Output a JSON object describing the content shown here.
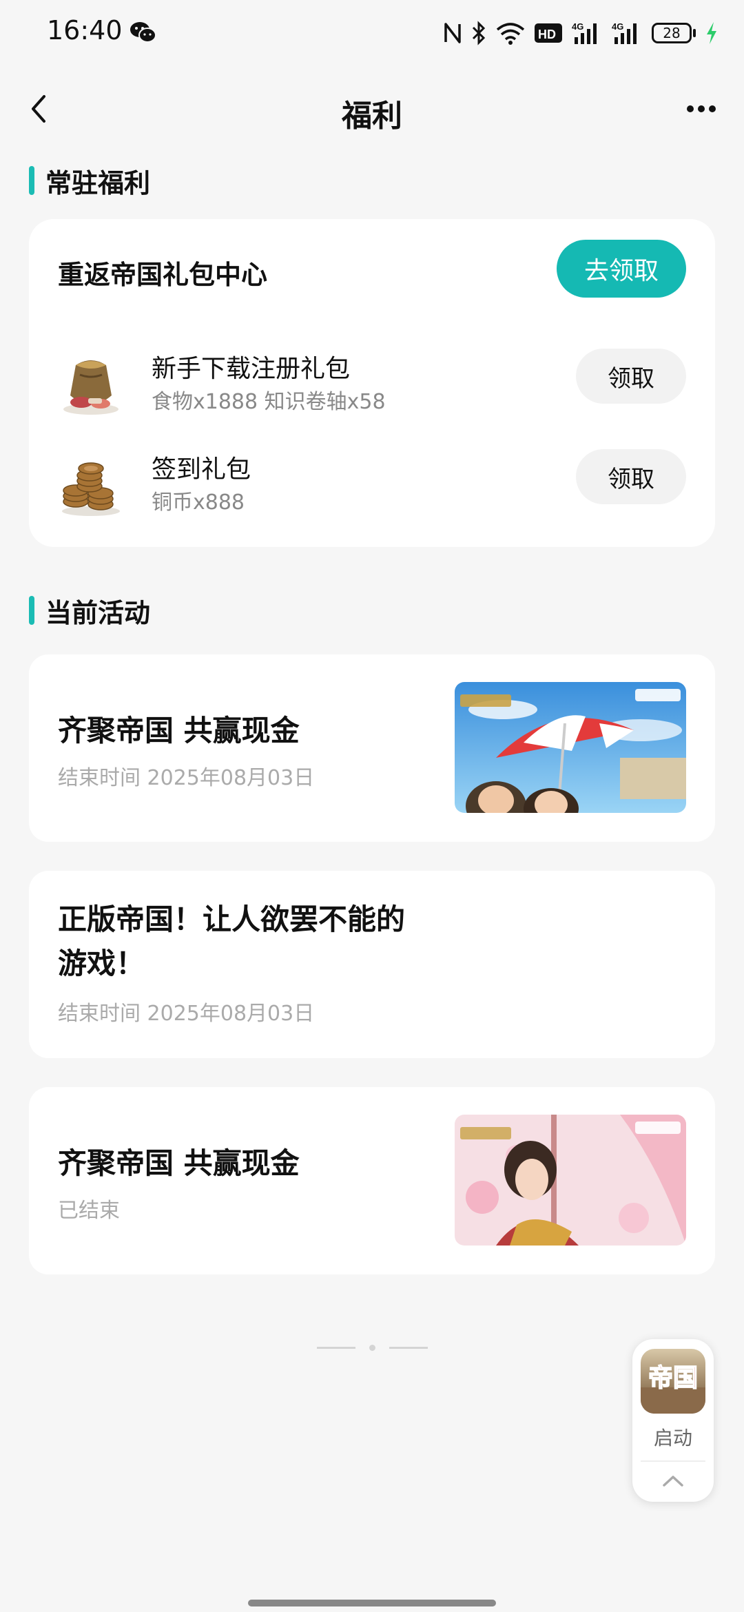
{
  "status_bar": {
    "time": "16:40",
    "network_4g_label": "4G",
    "hd_label": "HD",
    "battery": "28"
  },
  "nav": {
    "title": "福利"
  },
  "permanent_welfare": {
    "section_title": "常驻福利",
    "card_title": "重返帝国礼包中心",
    "claim_all_label": "去领取",
    "gifts": [
      {
        "name": "新手下载注册礼包",
        "desc": "食物x1888 知识卷轴x58",
        "button": "领取",
        "icon": "grain-sack-icon"
      },
      {
        "name": "签到礼包",
        "desc": "铜币x888",
        "button": "领取",
        "icon": "coin-stack-icon"
      }
    ]
  },
  "current_events": {
    "section_title": "当前活动",
    "items": [
      {
        "title": "齐聚帝国 共赢现金",
        "meta": "结束时间 2025年08月03日",
        "thumb": "umbrella-banner-image"
      },
      {
        "title_line1": "正版帝国！让人欲罢不能的",
        "title_line2": "游戏！",
        "meta": "结束时间 2025年08月03日"
      },
      {
        "title": "齐聚帝国 共赢现金",
        "meta": "已结束",
        "thumb": "empress-banner-image"
      }
    ]
  },
  "floating_launcher": {
    "label": "启动",
    "app_icon_text": "帝国"
  },
  "colors": {
    "accent": "#15b9b3",
    "background": "#f6f6f6"
  }
}
